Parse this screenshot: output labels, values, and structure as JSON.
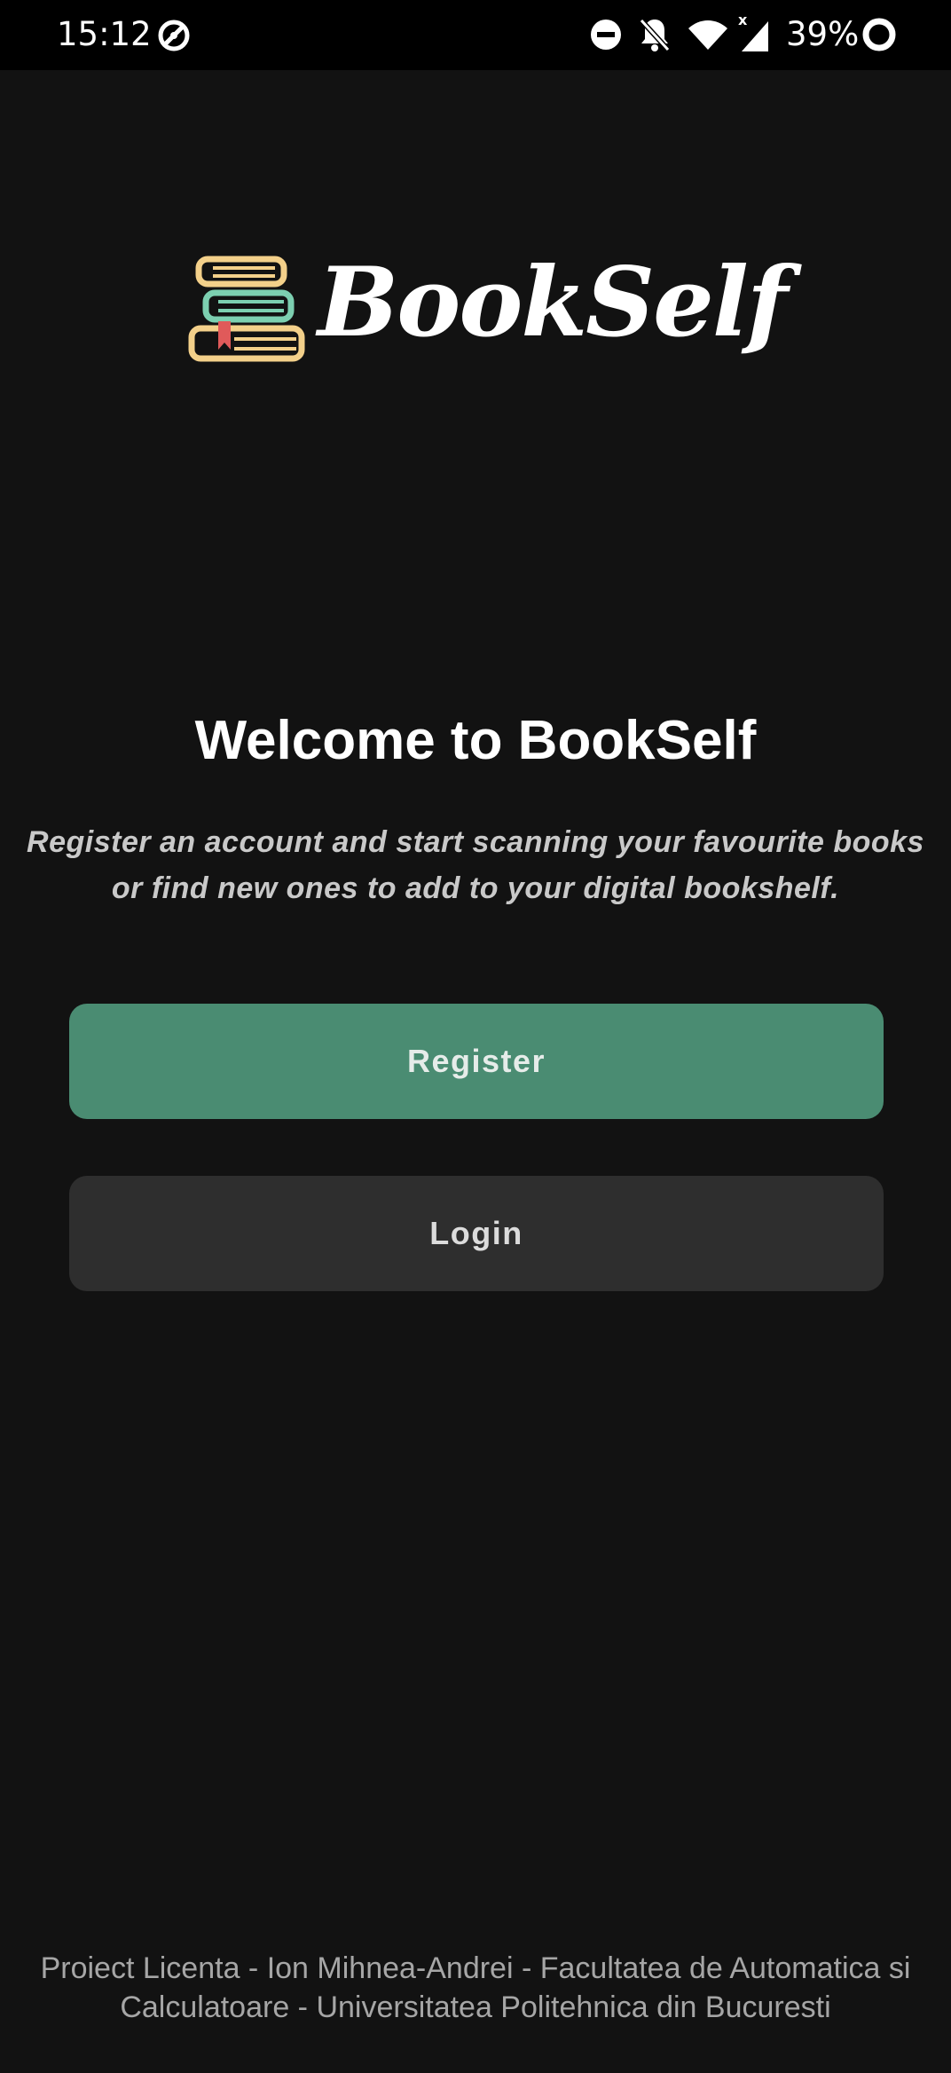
{
  "status_bar": {
    "time": "15:12",
    "battery_percent": "39%",
    "icons": [
      "vpn-icon",
      "do-not-disturb-icon",
      "notifications-off-icon",
      "wifi-icon",
      "signal-icon",
      "battery-icon"
    ]
  },
  "logo": {
    "text": "BookSelf",
    "icon": "books-stack-icon"
  },
  "welcome": {
    "title": "Welcome to BookSelf",
    "subtitle": "Register an account and start scanning your favourite books or find new ones to add to your digital bookshelf."
  },
  "buttons": {
    "register_label": "Register",
    "login_label": "Login"
  },
  "footer": {
    "text": "Proiect Licenta - Ion Mihnea-Andrei - Facultatea de Automatica si Calculatoare - Universitatea Politehnica din Bucuresti"
  },
  "colors": {
    "background": "#121212",
    "register_button": "#4a8c72",
    "login_button": "#2e2e2e"
  }
}
